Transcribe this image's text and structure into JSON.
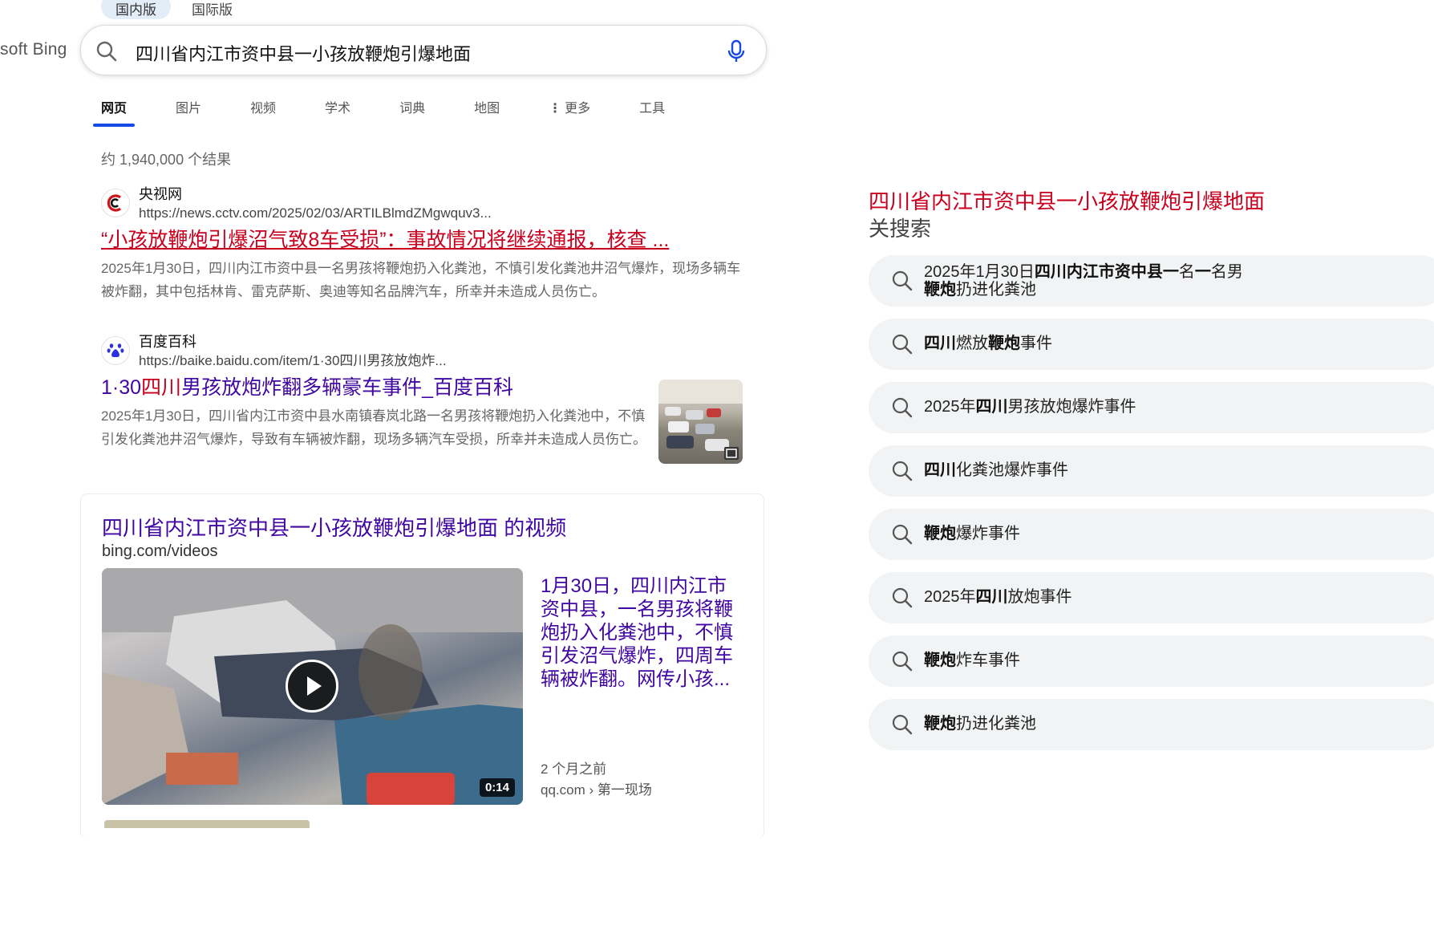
{
  "region_toggle": [
    "国内版",
    "国际版"
  ],
  "logo": "soft Bing",
  "search": {
    "query": "四川省内江市资中县一小孩放鞭炮引爆地面"
  },
  "tabs": [
    "网页",
    "图片",
    "视频",
    "学术",
    "词典",
    "地图",
    "更多",
    "工具"
  ],
  "result_count": "约 1,940,000 个结果",
  "results": [
    {
      "site": "央视网",
      "url": "https://news.cctv.com/2025/02/03/ARTILBlmdZMgwquv3...",
      "title_red": "“小孩放鞭炮引爆",
      "title_rest": "沼气致8车受损”：事故情况将继续通报，核查 ...",
      "snippet": "2025年1月30日，四川内江市资中县一名男孩将鞭炮扔入化粪池，不慎引发化粪池井沼气爆炸，现场多辆车被炸翻，其中包括林肯、雷克萨斯、奥迪等知名品牌汽车，所幸并未造成人员伤亡。"
    },
    {
      "site": "百度百科",
      "url": "https://baike.baidu.com/item/1·30四川男孩放炮炸...",
      "title_a": "1·30",
      "title_red": "四川",
      "title_b": "男孩放炮炸翻多辆豪车事件_百度百科",
      "snippet": "2025年1月30日，四川省内江市资中县水南镇春岚北路一名男孩将鞭炮扔入化粪池中，不慎引发化粪池井沼气爆炸，导致有车辆被炸翻，现场多辆汽车受损，所幸并未造成人员伤亡。"
    }
  ],
  "video_section": {
    "heading": "四川省内江市资中县一小孩放鞭炮引爆地面 的视频",
    "source": "bing.com/videos",
    "duration": "0:14",
    "description": "1月30日，四川内江市资中县，一名男孩将鞭炮扔入化粪池中，不慎引发沼气爆炸，四周车辆被炸翻。网传小孩...",
    "age": "2 个月之前",
    "publisher": "qq.com › 第一现场"
  },
  "related": {
    "title_query": "四川省内江市资中县一小孩放鞭炮引爆地面",
    "title_suffix": "关搜索",
    "items": [
      {
        "parts": [
          [
            "2025年1月30日",
            false
          ],
          [
            "四川内江市资中县一",
            true
          ],
          [
            "名",
            false
          ],
          [
            "一",
            true
          ],
          [
            "名男",
            false
          ]
        ],
        "line2": [
          [
            "鞭炮",
            true
          ],
          [
            "扔进化粪池",
            false
          ]
        ]
      },
      {
        "parts": [
          [
            "四川",
            true
          ],
          [
            "燃放",
            false
          ],
          [
            "鞭炮",
            true
          ],
          [
            "事件",
            false
          ]
        ]
      },
      {
        "parts": [
          [
            "2025年",
            false
          ],
          [
            "四川",
            true
          ],
          [
            "男孩放炮爆炸事件",
            false
          ]
        ]
      },
      {
        "parts": [
          [
            "四川",
            true
          ],
          [
            "化粪池爆炸事件",
            false
          ]
        ]
      },
      {
        "parts": [
          [
            "鞭炮",
            true
          ],
          [
            "爆炸事件",
            false
          ]
        ]
      },
      {
        "parts": [
          [
            "2025年",
            false
          ],
          [
            "四川",
            true
          ],
          [
            "放炮事件",
            false
          ]
        ]
      },
      {
        "parts": [
          [
            "鞭炮",
            true
          ],
          [
            "炸车事件",
            false
          ]
        ]
      },
      {
        "parts": [
          [
            "鞭炮",
            true
          ],
          [
            "扔进化粪池",
            false
          ]
        ]
      }
    ]
  },
  "colors": {
    "link": "#4007a2",
    "highlight": "#c8001e",
    "active_tab": "#174ae4"
  },
  "icons": [
    "search-icon",
    "microphone-icon",
    "more-dots-icon",
    "cctv-logo-icon",
    "baidu-paw-icon",
    "play-icon",
    "expand-icon"
  ]
}
